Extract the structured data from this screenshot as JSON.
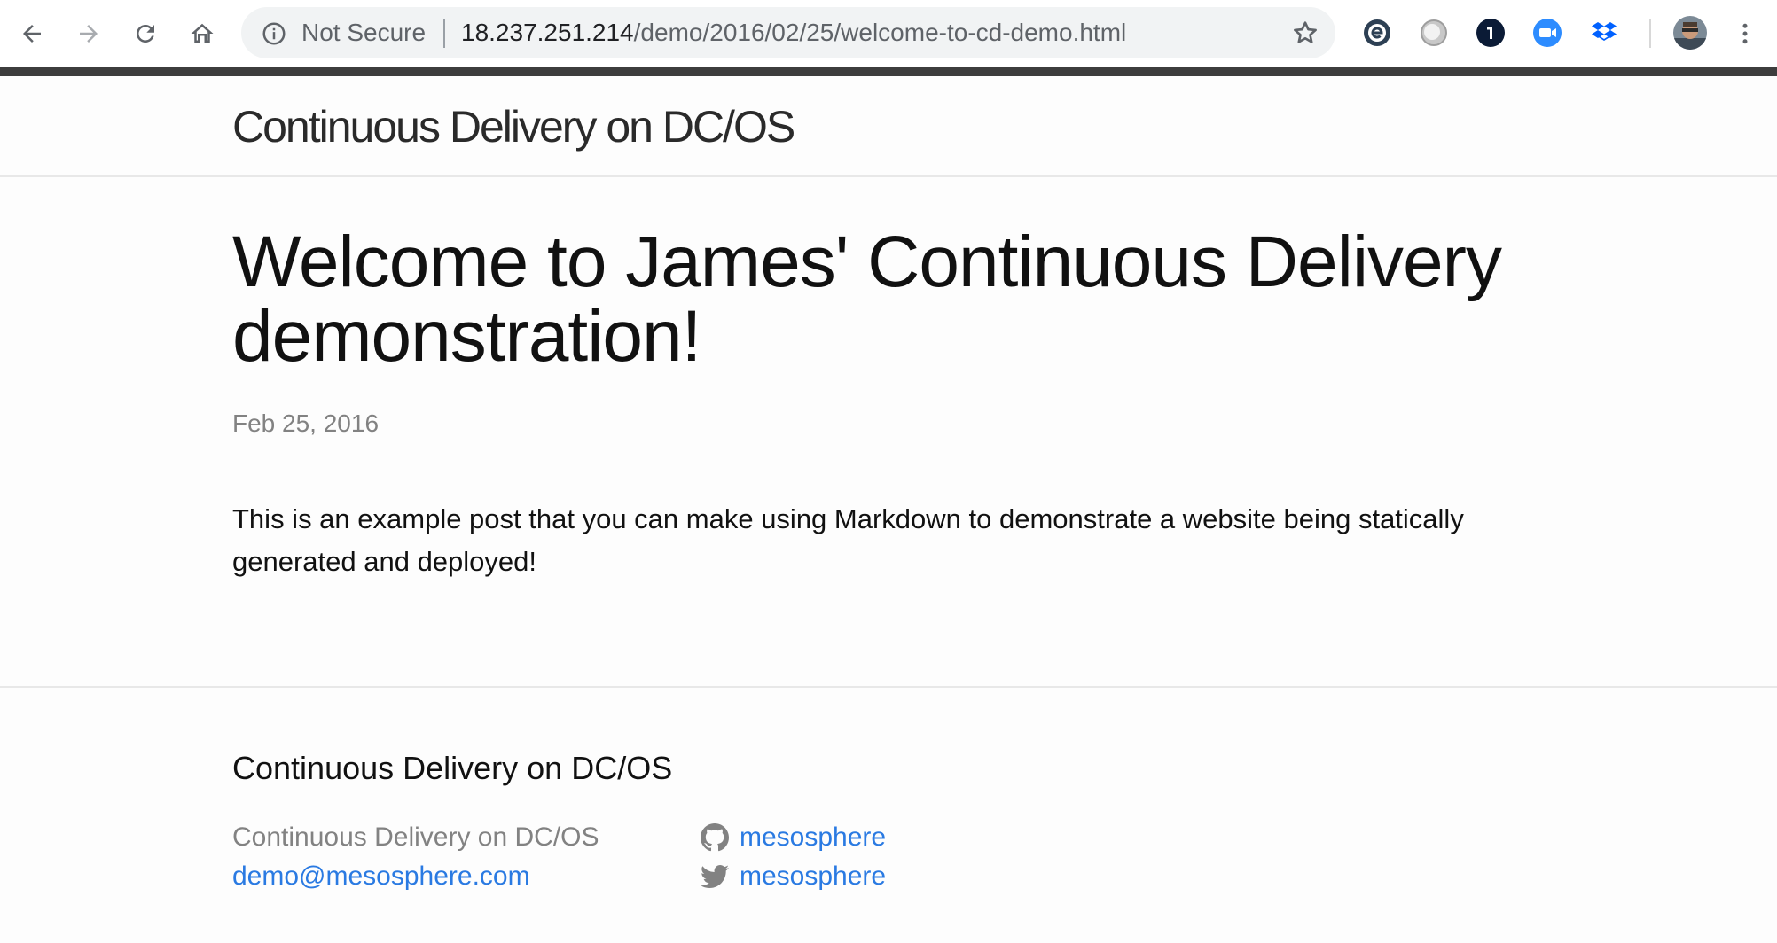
{
  "browser": {
    "back_icon": "arrow-left-icon",
    "forward_icon": "arrow-right-icon",
    "reload_icon": "reload-icon",
    "home_icon": "home-icon",
    "security_label": "Not Secure",
    "url_host": "18.237.251.214",
    "url_path": "/demo/2016/02/25/welcome-to-cd-demo.html",
    "bookmark_icon": "star-icon",
    "extensions": [
      "ghostery-icon",
      "grey-circle-icon",
      "1password-icon",
      "zoom-icon",
      "dropbox-icon"
    ],
    "menu_icon": "more-vert-icon"
  },
  "site": {
    "title": "Continuous Delivery on DC/OS"
  },
  "post": {
    "title": "Welcome to James' Continuous Delivery demonstration!",
    "date": "Feb 25, 2016",
    "body": "This is an example post that you can make using Markdown to demonstrate a website being statically generated and deployed!"
  },
  "footer": {
    "heading": "Continuous Delivery on DC/OS",
    "name": "Continuous Delivery on DC/OS",
    "email": "demo@mesosphere.com",
    "github_user": "mesosphere",
    "twitter_user": "mesosphere"
  },
  "colors": {
    "link": "#2a7ae2",
    "meta": "#828282",
    "chrome_bar": "#3d3d3d",
    "page_bg": "#fdfdfd"
  }
}
